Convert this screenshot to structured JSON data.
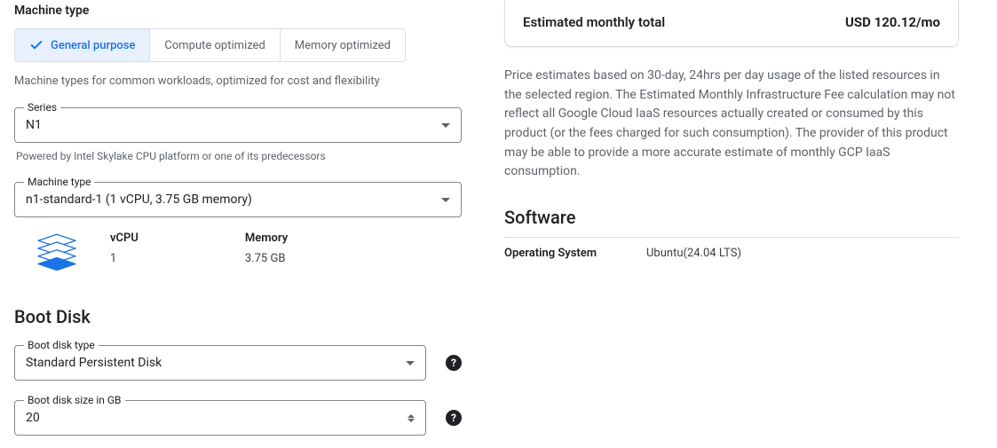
{
  "machine": {
    "title": "Machine type",
    "tabs": [
      {
        "label": "General purpose",
        "active": true
      },
      {
        "label": "Compute optimized",
        "active": false
      },
      {
        "label": "Memory optimized",
        "active": false
      }
    ],
    "tab_desc": "Machine types for common workloads, optimized for cost and flexibility",
    "series": {
      "label": "Series",
      "value": "N1",
      "hint": "Powered by Intel Skylake CPU platform or one of its predecessors"
    },
    "machine_type": {
      "label": "Machine type",
      "value": "n1-standard-1 (1 vCPU, 3.75 GB memory)"
    },
    "specs": {
      "vcpu_label": "vCPU",
      "vcpu_value": "1",
      "memory_label": "Memory",
      "memory_value": "3.75 GB"
    }
  },
  "boot_disk": {
    "title": "Boot Disk",
    "type": {
      "label": "Boot disk type",
      "value": "Standard Persistent Disk"
    },
    "size": {
      "label": "Boot disk size in GB",
      "value": "20"
    }
  },
  "estimate": {
    "label": "Estimated monthly total",
    "value": "USD 120.12/mo"
  },
  "disclaimer": "Price estimates based on 30-day, 24hrs per day usage of the listed resources in the selected region. The Estimated Monthly Infrastructure Fee calculation may not reflect all Google Cloud IaaS resources actually created or consumed by this product (or the fees charged for such consumption). The provider of this product may be able to provide a more accurate estimate of monthly GCP IaaS consumption.",
  "software": {
    "title": "Software",
    "os_label": "Operating System",
    "os_value": "Ubuntu(24.04 LTS)"
  }
}
